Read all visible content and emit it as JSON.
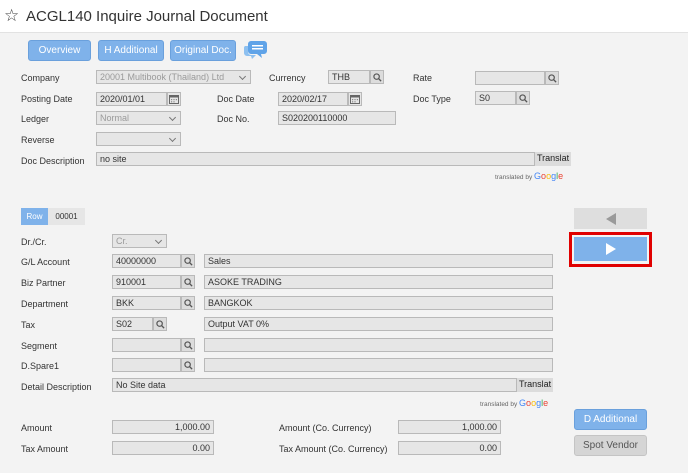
{
  "header": {
    "star_glyph": "☆",
    "title": "ACGL140 Inquire Journal Document"
  },
  "toolbar": {
    "overview": "Overview",
    "h_additional": "H Additional",
    "original_doc": "Original Doc."
  },
  "header_form": {
    "company_label": "Company",
    "company_value": "20001 Multibook (Thailand) Ltd",
    "currency_label": "Currency",
    "currency_value": "THB",
    "rate_label": "Rate",
    "rate_value": "",
    "posting_date_label": "Posting Date",
    "posting_date_value": "2020/01/01",
    "doc_date_label": "Doc Date",
    "doc_date_value": "2020/02/17",
    "doc_type_label": "Doc Type",
    "doc_type_value": "S0",
    "ledger_label": "Ledger",
    "ledger_value": "Normal",
    "doc_no_label": "Doc No.",
    "doc_no_value": "S020200110000",
    "reverse_label": "Reverse",
    "reverse_value": "",
    "doc_description_label": "Doc Description",
    "doc_description_value": "no site",
    "translate_label": "Translat",
    "translated_by": "translated by",
    "google_letters": [
      "G",
      "o",
      "o",
      "g",
      "l",
      "e"
    ]
  },
  "row_section": {
    "row_tab": "Row",
    "row_number": "00001"
  },
  "line_form": {
    "dr_cr_label": "Dr./Cr.",
    "dr_cr_value": "Cr.",
    "gl_account_label": "G/L Account",
    "gl_account_code": "40000000",
    "gl_account_name": "Sales",
    "biz_partner_label": "Biz Partner",
    "biz_partner_code": "910001",
    "biz_partner_name": "ASOKE TRADING",
    "department_label": "Department",
    "department_code": "BKK",
    "department_name": "BANGKOK",
    "tax_label": "Tax",
    "tax_code": "S02",
    "tax_name": "Output VAT 0%",
    "segment_label": "Segment",
    "segment_code": "",
    "segment_name": "",
    "dspare1_label": "D.Spare1",
    "dspare1_code": "",
    "dspare1_name": "",
    "detail_description_label": "Detail Description",
    "detail_description_value": "No Site data",
    "translate_label": "Translat",
    "translated_by": "translated by"
  },
  "amounts": {
    "amount_label": "Amount",
    "amount_value": "1,000.00",
    "amount_cc_label": "Amount (Co. Currency)",
    "amount_cc_value": "1,000.00",
    "tax_amount_label": "Tax Amount",
    "tax_amount_value": "0.00",
    "tax_amount_cc_label": "Tax Amount (Co. Currency)",
    "tax_amount_cc_value": "0.00"
  },
  "side_actions": {
    "d_additional": "D Additional",
    "spot_vendor": "Spot Vendor"
  },
  "colors": {
    "accent": "#7fb2ea",
    "highlight_border": "#e00000"
  },
  "icons": [
    "star-icon",
    "chat-icon",
    "search-icon",
    "calendar-icon",
    "chevron-down-icon",
    "triangle-left-icon",
    "triangle-right-icon"
  ]
}
